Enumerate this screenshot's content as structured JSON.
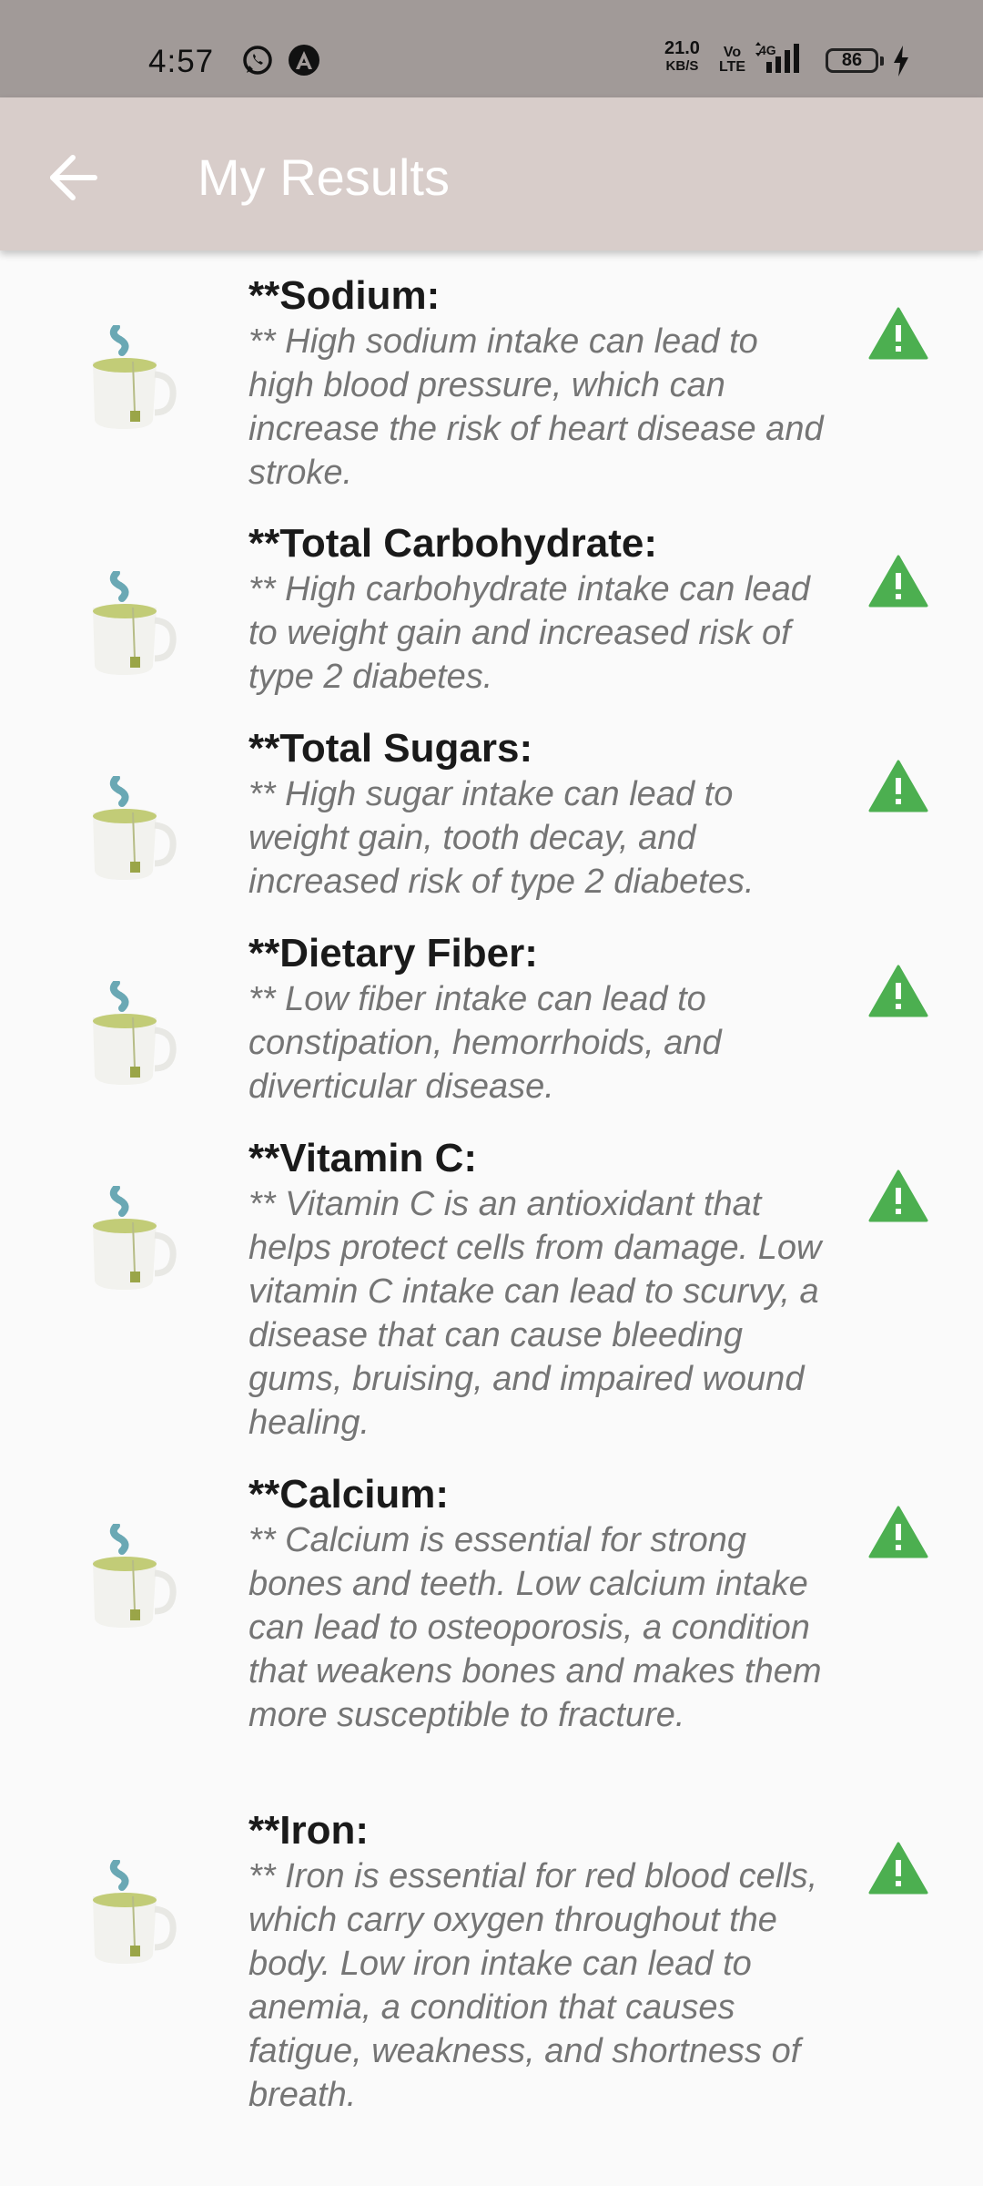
{
  "status_bar": {
    "time": "4:57",
    "net_speed_value": "21.0",
    "net_speed_unit": "KB/S",
    "volte": "Vo\nLTE",
    "network": "4G",
    "battery": "86",
    "icons": [
      "whatsapp-icon",
      "notification-a-icon",
      "signal-icon",
      "battery-icon",
      "charging-icon"
    ]
  },
  "app_bar": {
    "title": "My Results",
    "back_icon": "arrow-back-icon",
    "background": "#d8cdca"
  },
  "results": [
    {
      "title": "**Sodium:",
      "description": "** High sodium intake can lead to high blood pressure, which can increase the risk of heart disease and stroke."
    },
    {
      "title": "**Total Carbohydrate:",
      "description": "** High carbohydrate intake can lead to weight gain and increased risk of type 2 diabetes."
    },
    {
      "title": "**Total Sugars:",
      "description": "** High sugar intake can lead to weight gain, tooth decay, and increased risk of type 2 diabetes."
    },
    {
      "title": "**Dietary Fiber:",
      "description": "** Low fiber intake can lead to constipation, hemorrhoids, and diverticular disease."
    },
    {
      "title": "**Vitamin C:",
      "description": "** Vitamin C is an antioxidant that helps protect cells from damage. Low vitamin C intake can lead to scurvy, a disease that can cause bleeding gums, bruising, and impaired wound healing."
    },
    {
      "title": "**Calcium:",
      "description": "** Calcium is essential for strong bones and teeth. Low calcium intake can lead to osteoporosis, a condition that weakens bones and makes them more susceptible to fracture."
    },
    {
      "title": "**Iron:",
      "description": "** Iron is essential for red blood cells, which carry oxygen throughout the body. Low iron intake can lead to anemia, a condition that causes fatigue, weakness, and shortness of breath."
    }
  ],
  "item_icons": {
    "thumbnail": "tea-cup-icon",
    "status": "warning-triangle-icon"
  },
  "colors": {
    "warning": "#4caf50",
    "title": "#1a1a1a",
    "description": "#757575",
    "status_bar": "#a19a98"
  }
}
